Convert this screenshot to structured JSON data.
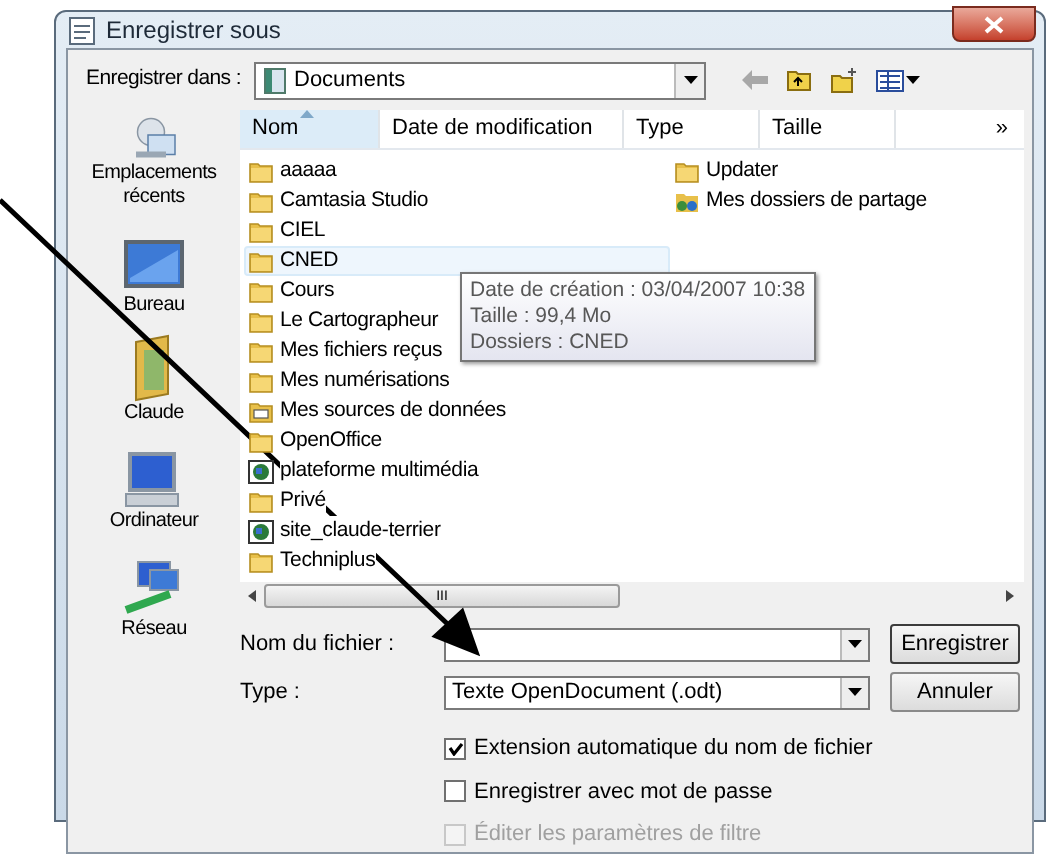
{
  "window": {
    "title": "Enregistrer sous"
  },
  "location": {
    "label": "Enregistrer dans :",
    "value": "Documents"
  },
  "places": [
    {
      "label": "Emplacements récents",
      "kind": "recent"
    },
    {
      "label": "Bureau",
      "kind": "desktop"
    },
    {
      "label": "Claude",
      "kind": "user"
    },
    {
      "label": "Ordinateur",
      "kind": "computer"
    },
    {
      "label": "Réseau",
      "kind": "network"
    }
  ],
  "columns": [
    {
      "label": "Nom",
      "sorted": true
    },
    {
      "label": "Date de modification",
      "sorted": false
    },
    {
      "label": "Type",
      "sorted": false
    },
    {
      "label": "Taille",
      "sorted": false
    }
  ],
  "more_columns": "»",
  "files": [
    [
      {
        "name": "aaaaa",
        "kind": "folder",
        "hovered": false
      },
      {
        "name": "Camtasia Studio",
        "kind": "folder",
        "hovered": false
      },
      {
        "name": "CIEL",
        "kind": "folder",
        "hovered": false
      },
      {
        "name": "CNED",
        "kind": "folder",
        "hovered": true
      },
      {
        "name": "Cours",
        "kind": "folder",
        "hovered": false
      },
      {
        "name": "Le Cartographeur",
        "kind": "folder",
        "hovered": false
      },
      {
        "name": "Mes fichiers reçus",
        "kind": "folder",
        "hovered": false
      },
      {
        "name": "Mes numérisations",
        "kind": "folder",
        "hovered": false
      },
      {
        "name": "Mes sources de données",
        "kind": "datasource",
        "hovered": false
      },
      {
        "name": "OpenOffice",
        "kind": "folder",
        "hovered": false
      },
      {
        "name": "plateforme multimédia",
        "kind": "web",
        "hovered": false
      },
      {
        "name": "Privé",
        "kind": "folder",
        "hovered": false
      },
      {
        "name": "site_claude-terrier",
        "kind": "web",
        "hovered": false
      },
      {
        "name": "Techniplus",
        "kind": "folder",
        "hovered": false
      }
    ],
    [
      {
        "name": "Updater",
        "kind": "folder",
        "hovered": false
      },
      {
        "name": "Mes dossiers de partage",
        "kind": "shared",
        "hovered": false
      }
    ]
  ],
  "tooltip": [
    "Date de création : 03/04/2007 10:38",
    "Taille : 99,4 Mo",
    "Dossiers : CNED"
  ],
  "scroll_grip": "III",
  "filename": {
    "label": "Nom du fichier :"
  },
  "filetype": {
    "label": "Type :",
    "value": "Texte OpenDocument (.odt)"
  },
  "buttons": [
    "Enregistrer",
    "Annuler"
  ],
  "options": [
    {
      "label": "Extension automatique du nom de fichier",
      "checked": true,
      "disabled": false
    },
    {
      "label": "Enregistrer avec mot de passe",
      "checked": false,
      "disabled": false
    },
    {
      "label": "Éditer les paramètres de filtre",
      "checked": false,
      "disabled": true
    }
  ]
}
